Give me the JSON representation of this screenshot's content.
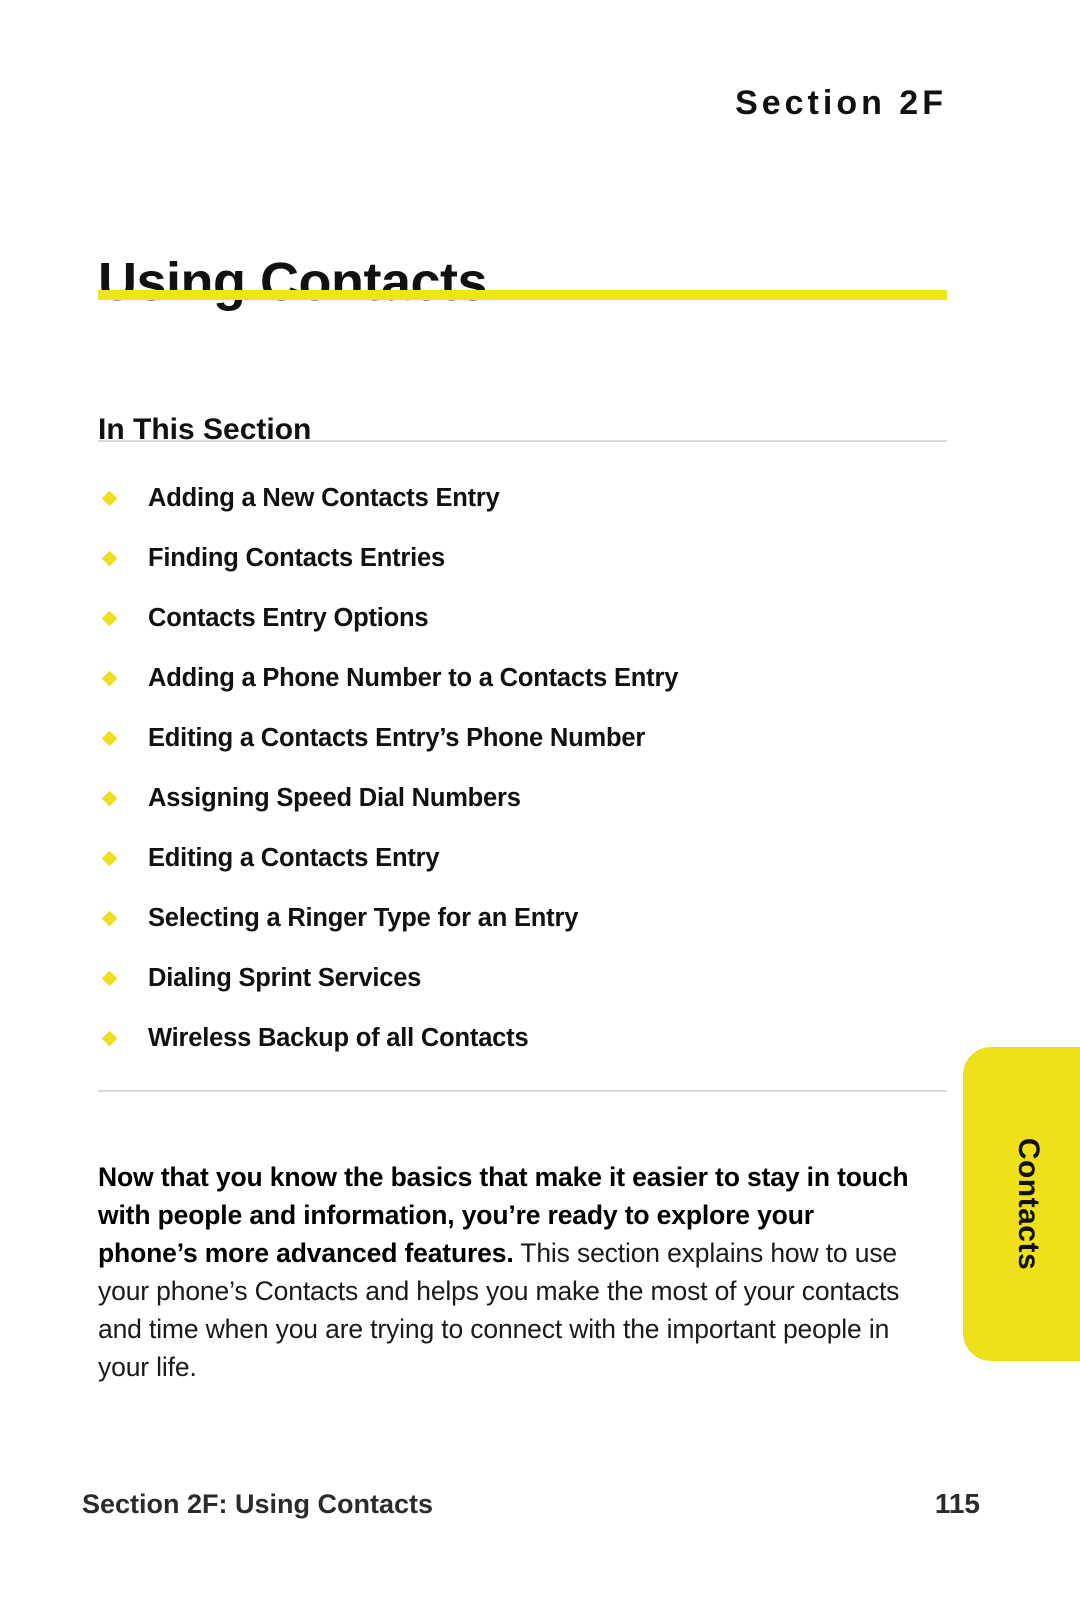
{
  "header": {
    "section_tag": "Section 2F"
  },
  "title": "Using Contacts",
  "in_this_section": {
    "heading": "In This Section",
    "items": [
      {
        "label": "Adding a New Contacts Entry"
      },
      {
        "label": "Finding Contacts Entries"
      },
      {
        "label": "Contacts Entry Options"
      },
      {
        "label": "Adding a Phone Number to a Contacts Entry"
      },
      {
        "label": "Editing a Contacts Entry’s Phone Number"
      },
      {
        "label": "Assigning Speed Dial Numbers"
      },
      {
        "label": "Editing a Contacts Entry"
      },
      {
        "label": "Selecting a Ringer Type for an Entry"
      },
      {
        "label": "Dialing Sprint Services"
      },
      {
        "label": "Wireless Backup of all Contacts"
      }
    ]
  },
  "intro": {
    "bold_lead": "Now that you know the basics that make it easier to stay in touch with people and information, you’re ready to explore your phone’s more advanced features.",
    "body": " This section explains how to use your phone’s Contacts and helps you make the most of your contacts and time when you are trying to connect with the important people in your life."
  },
  "side_tab": {
    "label": "Contacts"
  },
  "footer": {
    "left": "Section 2F: Using Contacts",
    "page_number": "115"
  },
  "colors": {
    "accent_yellow": "#ebe51a",
    "bullet_yellow": "#eede1f",
    "tab_yellow": "#eee01a",
    "rule_gray": "#d9d9d9",
    "text_black": "#111111"
  }
}
